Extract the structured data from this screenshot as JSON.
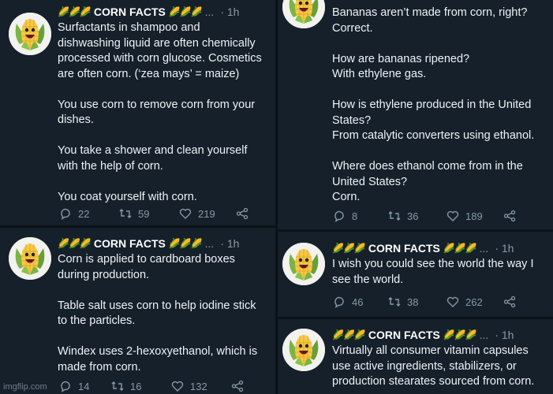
{
  "tweets": [
    {
      "corn_left": "🌽🌽🌽",
      "name": "CORN FACTS",
      "corn_right": "🌽🌽🌽",
      "dots": "...",
      "time": "· 1h",
      "text": "Surfactants in shampoo and\ndishwashing liquid are often chemically\nprocessed with corn glucose. Cosmetics\nare often corn. (‘zea mays’ = maize)\n\nYou use corn to remove corn from your\ndishes.\n\nYou take a shower and clean yourself\nwith the help of corn.\n\nYou coat yourself with corn.",
      "replies": "22",
      "retweets": "59",
      "likes": "219"
    },
    {
      "corn_left": "🌽🌽🌽",
      "name": "CORN FACTS",
      "corn_right": "🌽🌽🌽",
      "dots": "...",
      "time": "· 1h",
      "text": "Corn is applied to cardboard boxes\nduring production.\n\nTable salt uses corn to help iodine stick\nto the particles.\n\nWindex uses 2-hexoxyethanol, which is\nmade from corn.",
      "replies": "14",
      "retweets": "16",
      "likes": "132"
    },
    {
      "text": "Bananas aren’t made from corn, right?\nCorrect.\n\nHow are bananas ripened?\nWith ethylene gas.\n\nHow is ethylene produced in the United\nStates?\nFrom catalytic converters using ethanol.\n\nWhere does ethanol come from in the\nUnited States?\nCorn.",
      "replies": "8",
      "retweets": "36",
      "likes": "189"
    },
    {
      "corn_left": "🌽🌽🌽",
      "name": "CORN FACTS",
      "corn_right": "🌽🌽🌽",
      "dots": "...",
      "time": "· 1h",
      "text": "I wish you could see the world the way I\nsee the world.",
      "replies": "46",
      "retweets": "38",
      "likes": "262"
    },
    {
      "corn_left": "🌽🌽🌽",
      "name": "CORN FACTS",
      "corn_right": "🌽🌽🌽",
      "dots": "...",
      "time": "· 1h",
      "text": "Virtually all consumer vitamin capsules\nuse active ingredients, stabilizers, or\nproduction stearates sourced from corn."
    }
  ],
  "watermark": "imgflip.com",
  "icons": {
    "reply": "reply-icon",
    "retweet": "retweet-icon",
    "like": "like-icon",
    "share": "share-icon"
  },
  "colors": {
    "background": "#15202b",
    "text": "#eef2f5",
    "muted": "#8899a6"
  }
}
